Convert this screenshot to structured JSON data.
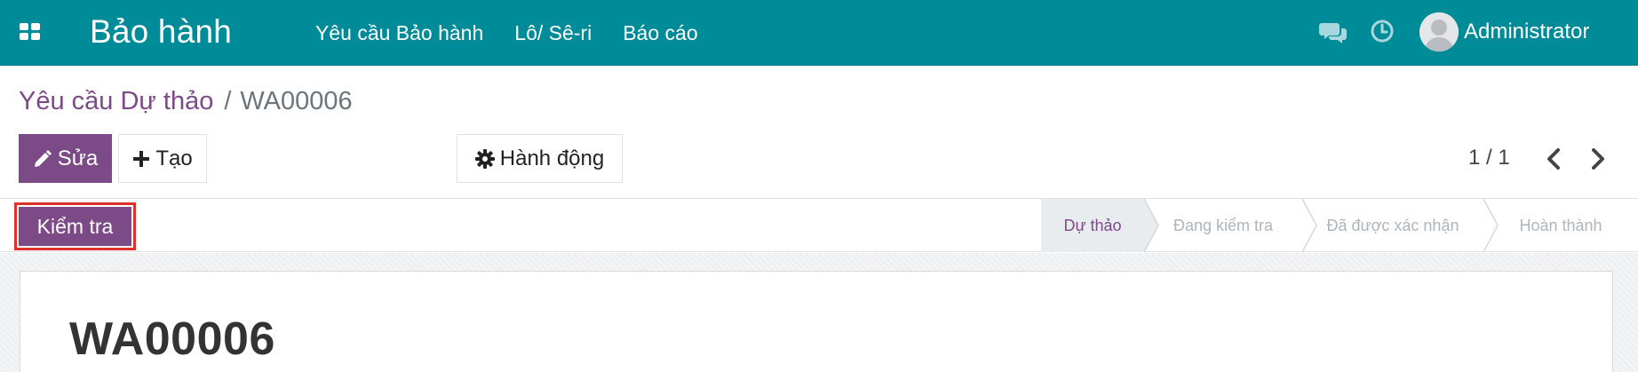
{
  "navbar": {
    "app_title": "Bảo hành",
    "menu": [
      "Yêu cầu Bảo hành",
      "Lô/ Sê-ri",
      "Báo cáo"
    ],
    "user_name": "Administrator",
    "icons": [
      "apps-grid-icon",
      "chat-icon",
      "clock-icon",
      "avatar"
    ],
    "bg_color": "#008b99"
  },
  "breadcrumb": {
    "parent": "Yêu cầu Dự thảo",
    "separator": "/",
    "current": "WA00006"
  },
  "toolbar": {
    "edit_label": "Sửa",
    "create_label": "Tạo",
    "action_label": "Hành động"
  },
  "pager": {
    "value": "1 / 1"
  },
  "statusbar": {
    "check_button_label": "Kiểm tra",
    "stages": [
      "Dự thảo",
      "Đang kiểm tra",
      "Đã được xác nhận",
      "Hoàn thành"
    ],
    "active_stage": "Dự thảo"
  },
  "record": {
    "name": "WA00006"
  },
  "colors": {
    "primary": "#7c4a87",
    "highlight_frame": "#e0302a"
  }
}
